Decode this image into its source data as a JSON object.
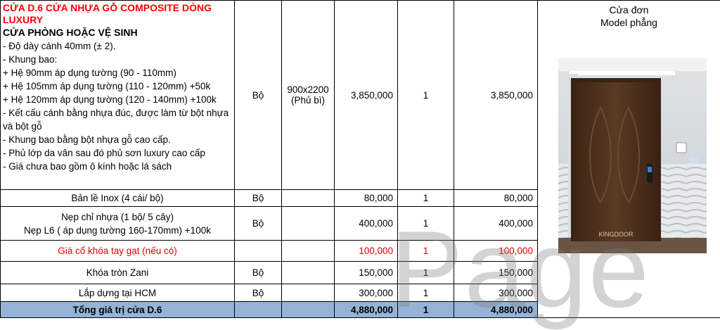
{
  "product": {
    "title": "CỬA D.6 CỬA NHỰA GỖ COMPOSITE DÒNG LUXURY",
    "subtitle": "CỬA PHÒNG HOẶC VỆ SINH",
    "details": [
      "- Độ dày cánh 40mm (± 2).",
      "- Khung bao:",
      "+ Hệ 90mm áp dụng tường (90 - 110mm)",
      "+ Hệ 105mm áp dụng tường (110 - 120mm) +50k",
      "+ Hệ 120mm áp dụng tường (120 - 140mm) +100k",
      "- Kết cấu cánh bằng nhựa đúc, được làm từ bột nhựa và bột gỗ",
      "- Khung bao bằng bột nhựa gỗ cao cấp.",
      "- Phủ lớp da vân sau đó phủ sơn luxury cao cấp",
      "- Giá chưa bao gồm ô kính hoặc lá sách"
    ],
    "unit": "Bộ",
    "size_line1": "900x2200",
    "size_line2": "(Phủ bì)",
    "price": "3,850,000",
    "qty": "1",
    "amount": "3,850,000",
    "model_line1": "Cửa đơn",
    "model_line2": "Model phẳng",
    "logo_text": "KINGDOOR"
  },
  "rows": [
    {
      "name": "Bản lề Inox  (4 cái/ bộ)",
      "unit": "Bộ",
      "price": "80,000",
      "qty": "1",
      "amount": "80,000"
    },
    {
      "name_line1": "Nẹp chỉ nhựa (1 bộ/ 5 cây)",
      "name_line2": "Nẹp L6 ( áp dụng tường 160-170mm) +100k",
      "unit": "Bộ",
      "price": "400,000",
      "qty": "1",
      "amount": "400,000"
    },
    {
      "name": "Giá cổ khóa tay gạt (nếu có)",
      "unit": "",
      "price": "100,000",
      "qty": "1",
      "amount": "100,000"
    },
    {
      "name": "Khóa tròn Zani",
      "unit": "Bộ",
      "price": "150,000",
      "qty": "1",
      "amount": "150,000"
    },
    {
      "name": "Lắp dựng tại HCM",
      "unit": "Bộ",
      "price": "300,000",
      "qty": "1",
      "amount": "300,000"
    }
  ],
  "total": {
    "label": "Tổng giá trị cửa D.6",
    "price": "4,880,000",
    "qty": "1",
    "amount": "4,880,000"
  },
  "watermark": "Page",
  "colors": {
    "title_red": "#ff0000",
    "total_bg": "#95b3d7",
    "door": "#4a2e1a"
  }
}
